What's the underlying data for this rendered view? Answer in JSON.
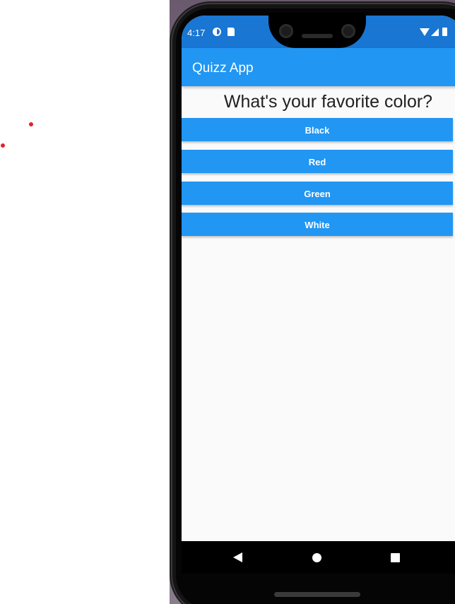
{
  "status_bar": {
    "time": "4:17",
    "icons": [
      "data-saver-icon",
      "sd-card-icon",
      "wifi-icon",
      "signal-icon",
      "battery-icon"
    ]
  },
  "app_bar": {
    "title": "Quizz App",
    "background_color": "#2196f3",
    "status_bar_color": "#1976d2"
  },
  "quiz": {
    "question": "What's your favorite color?",
    "answers": [
      {
        "label": "Black"
      },
      {
        "label": "Red"
      },
      {
        "label": "Green"
      },
      {
        "label": "White"
      }
    ]
  },
  "nav_bar": {
    "icons": [
      "back-icon",
      "home-icon",
      "recents-icon"
    ]
  },
  "colors": {
    "accent": "#2196f3",
    "screen_background": "#fafafa",
    "dots": "#e0242b"
  }
}
